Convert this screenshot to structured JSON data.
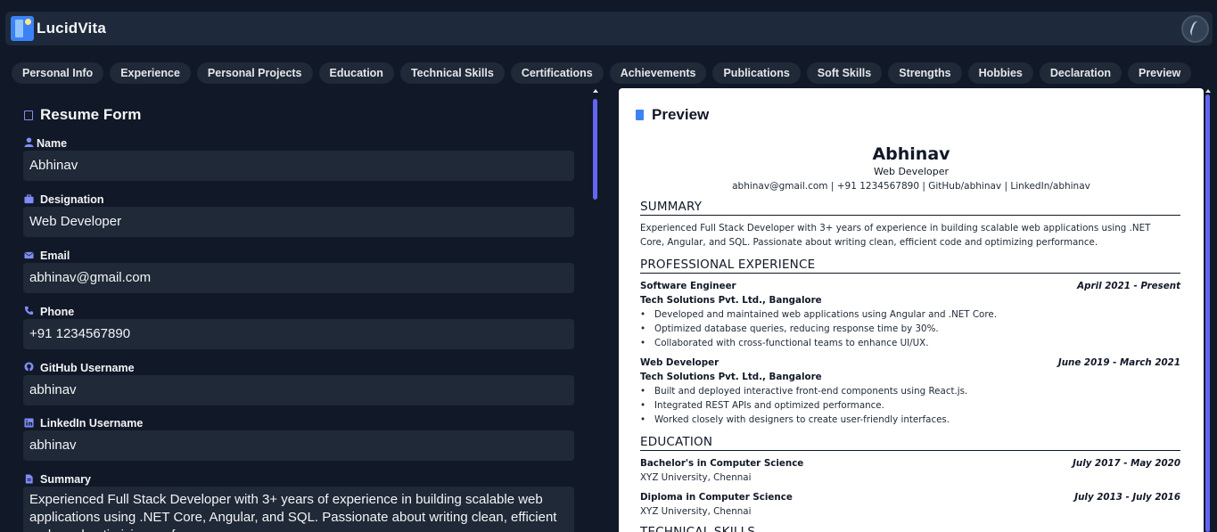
{
  "app": {
    "title": "LucidVita"
  },
  "tabs": [
    "Personal Info",
    "Experience",
    "Personal Projects",
    "Education",
    "Technical Skills",
    "Certifications",
    "Achievements",
    "Publications",
    "Soft Skills",
    "Strengths",
    "Hobbies",
    "Declaration",
    "Preview"
  ],
  "form": {
    "title": "Resume Form",
    "fields": [
      {
        "label": "Name",
        "icon": "user-icon",
        "value": "Abhinav"
      },
      {
        "label": "Designation",
        "icon": "briefcase-icon",
        "value": "Web Developer"
      },
      {
        "label": "Email",
        "icon": "envelope-icon",
        "value": "abhinav@gmail.com"
      },
      {
        "label": "Phone",
        "icon": "phone-icon",
        "value": "+91 1234567890"
      },
      {
        "label": "GitHub Username",
        "icon": "github-icon",
        "value": "abhinav"
      },
      {
        "label": "LinkedIn Username",
        "icon": "linkedin-icon",
        "value": "abhinav"
      }
    ],
    "summary": {
      "label": "Summary",
      "icon": "document-icon",
      "value": "Experienced Full Stack Developer with 3+ years of experience in building scalable web applications using .NET Core, Angular, and SQL. Passionate about writing clean, efficient code and optimizing performance."
    }
  },
  "preview": {
    "title": "Preview",
    "name": "Abhinav",
    "role": "Web Developer",
    "contact": "abhinav@gmail.com | +91 1234567890 | GitHub/abhinav | LinkedIn/abhinav",
    "sections": {
      "summary": "SUMMARY",
      "experience": "PROFESSIONAL EXPERIENCE",
      "education": "EDUCATION",
      "technical": "TECHNICAL SKILLS"
    },
    "summary_text": "Experienced Full Stack Developer with 3+ years of experience in building scalable web applications using .NET Core, Angular, and SQL. Passionate about writing clean, efficient code and optimizing performance.",
    "experience": [
      {
        "title": "Software Engineer",
        "dates": "April 2021 - Present",
        "company": "Tech Solutions Pvt. Ltd., Bangalore",
        "bullets": [
          "Developed and maintained web applications using Angular and .NET Core.",
          "Optimized database queries, reducing response time by 30%.",
          "Collaborated with cross-functional teams to enhance UI/UX."
        ]
      },
      {
        "title": "Web Developer",
        "dates": "June 2019 - March 2021",
        "company": "Tech Solutions Pvt. Ltd., Bangalore",
        "bullets": [
          "Built and deployed interactive front-end components using React.js.",
          "Integrated REST APIs and optimized performance.",
          "Worked closely with designers to create user-friendly interfaces."
        ]
      }
    ],
    "education": [
      {
        "degree": "Bachelor's in Computer Science",
        "dates": "July 2017 - May 2020",
        "school": "XYZ University, Chennai"
      },
      {
        "degree": "Diploma in Computer Science",
        "dates": "July 2013 - July 2016",
        "school": "XYZ University, Chennai"
      }
    ]
  },
  "colors": {
    "accent": "#6366f1",
    "background": "#111827",
    "surface": "#1f2937",
    "header": "#1e293b"
  }
}
